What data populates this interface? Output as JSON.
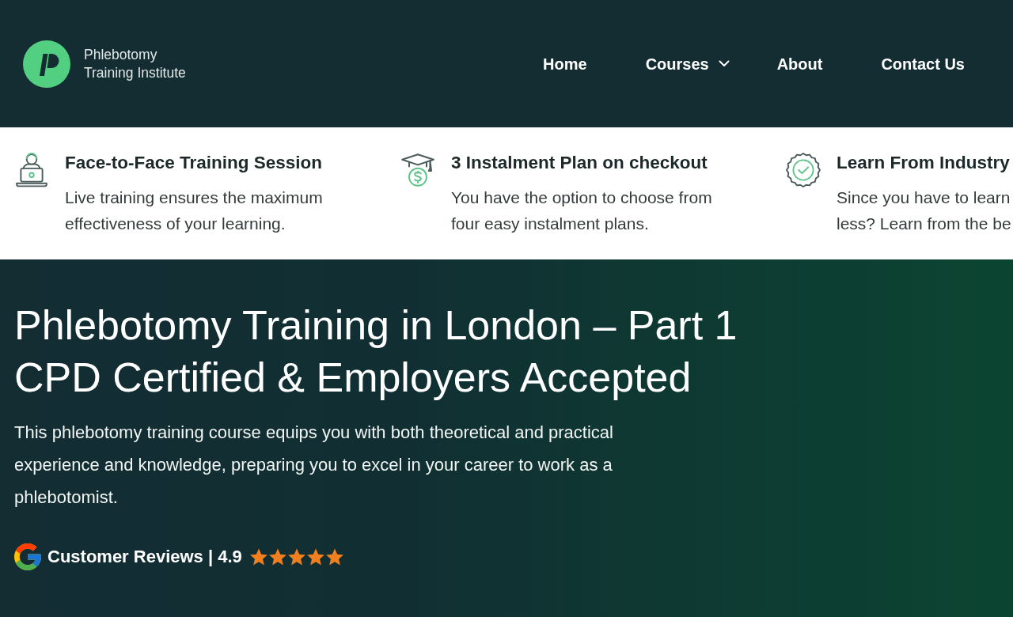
{
  "header": {
    "logo": {
      "name_lines": [
        "Phlebotomy",
        "Training Institute"
      ]
    },
    "nav": [
      {
        "label": "Home",
        "kind": "link"
      },
      {
        "label": "Courses",
        "kind": "dropdown"
      },
      {
        "label": "About",
        "kind": "link"
      },
      {
        "label": "Contact Us",
        "kind": "link"
      }
    ]
  },
  "features": [
    {
      "title": "Face-to-Face Training Session",
      "description_lines": [
        "Live training ensures the maximum",
        "effectiveness of your learning."
      ]
    },
    {
      "title": "3 Instalment Plan on checkout",
      "description_lines": [
        "You have the option to choose from",
        "four easy instalment plans."
      ]
    },
    {
      "title": "Learn From Industry",
      "description_lines": [
        "Since you have to learn",
        "less? Learn from the be"
      ]
    }
  ],
  "hero": {
    "title_lines": [
      "Phlebotomy Training in London – Part 1",
      "CPD Certified & Employers Accepted"
    ],
    "description": "This phlebotomy training course equips you with both theoretical and practical experience and knowledge, preparing you to excel in your career to work as a phlebotomist.",
    "reviews": {
      "label": "Customer Reviews | 4.9",
      "stars": 5
    }
  }
}
